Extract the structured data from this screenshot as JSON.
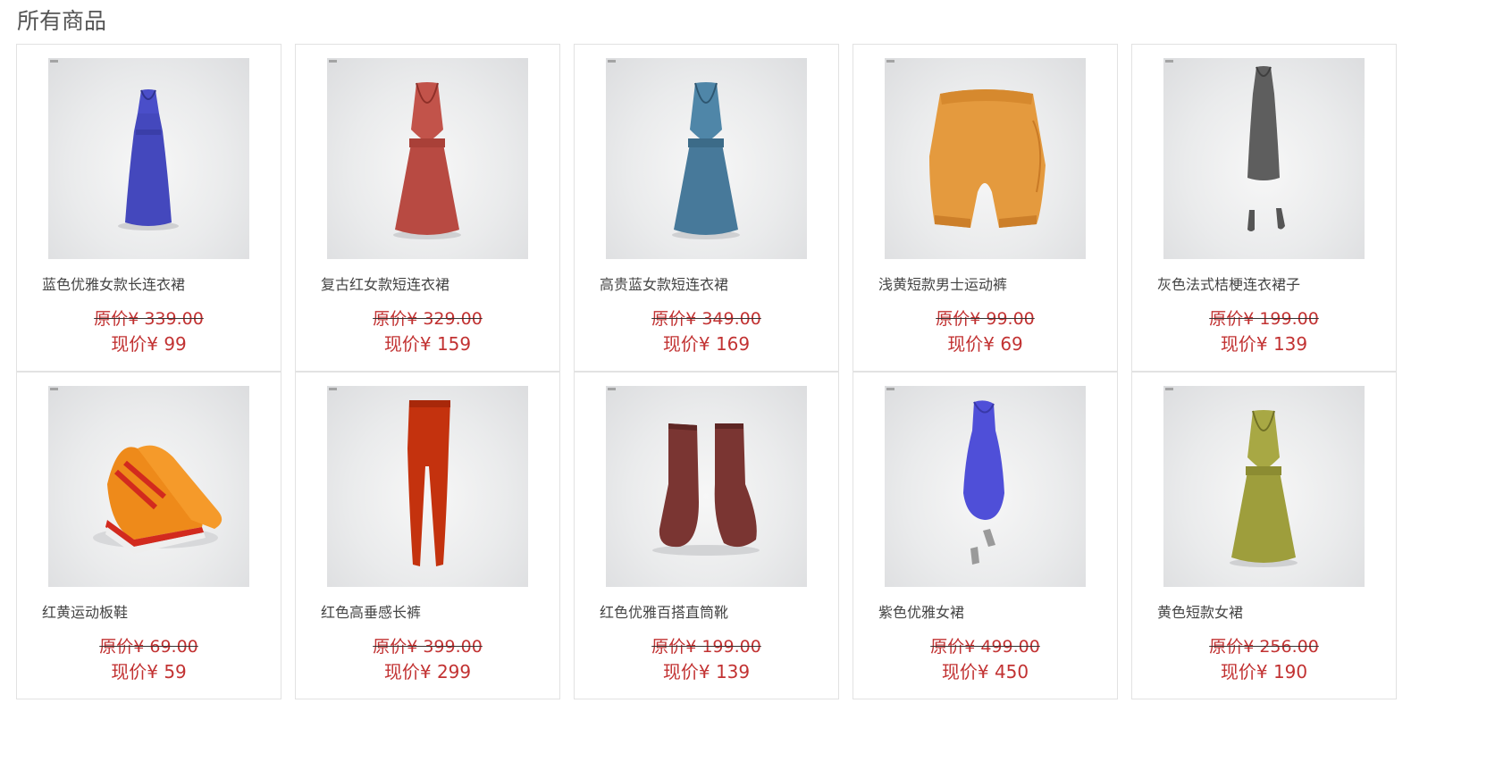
{
  "page": {
    "title": "所有商品"
  },
  "products": [
    {
      "name": "蓝色优雅女款长连衣裙",
      "orig_price": "原价¥ 339.00",
      "now_price": "现价¥ 99",
      "icon": "blue-halter-long-dress",
      "color": "#4a4ec9"
    },
    {
      "name": "复古红女款短连衣裙",
      "orig_price": "原价¥ 329.00",
      "now_price": "现价¥ 159",
      "icon": "red-halter-short-dress",
      "color": "#c2534a"
    },
    {
      "name": "高贵蓝女款短连衣裙",
      "orig_price": "原价¥ 349.00",
      "now_price": "现价¥ 169",
      "icon": "teal-halter-short-dress",
      "color": "#4f86a8"
    },
    {
      "name": "浅黄短款男士运动裤",
      "orig_price": "原价¥ 99.00",
      "now_price": "现价¥ 69",
      "icon": "orange-sport-shorts",
      "color": "#e49a3e"
    },
    {
      "name": "灰色法式桔梗连衣裙子",
      "orig_price": "原价¥ 199.00",
      "now_price": "现价¥ 139",
      "icon": "gray-sheath-dress",
      "color": "#5e5e5e"
    },
    {
      "name": "红黄运动板鞋",
      "orig_price": "原价¥ 69.00",
      "now_price": "现价¥ 59",
      "icon": "red-yellow-sneakers",
      "color": "#ee8a1a"
    },
    {
      "name": "红色高垂感长裤",
      "orig_price": "原价¥ 399.00",
      "now_price": "现价¥ 299",
      "icon": "red-long-pants",
      "color": "#c4320e"
    },
    {
      "name": "红色优雅百搭直筒靴",
      "orig_price": "原价¥ 199.00",
      "now_price": "现价¥ 139",
      "icon": "brown-boots",
      "color": "#7a3532"
    },
    {
      "name": "紫色优雅女裙",
      "orig_price": "原价¥ 499.00",
      "now_price": "现价¥ 450",
      "icon": "purple-bodycon-dress",
      "color": "#4f4fd8"
    },
    {
      "name": "黄色短款女裙",
      "orig_price": "原价¥ 256.00",
      "now_price": "现价¥ 190",
      "icon": "olive-halter-short-dress",
      "color": "#a8a844"
    }
  ]
}
